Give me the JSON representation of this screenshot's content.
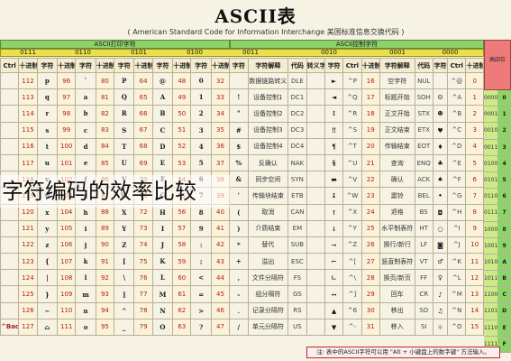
{
  "title": "ASCII表",
  "subtitle": "( American Standard Code for Information Interchange   美国标准信息交换代码 )",
  "overlay_caption": "字符编码的效率比较",
  "headers": {
    "printable": "ASCII打印字符",
    "control": "ASCII控制字符",
    "corner": "高四位"
  },
  "high_bits": [
    "0111",
    "0110",
    "0101",
    "0100",
    "0011",
    "0010",
    "0001",
    "0000"
  ],
  "col_heads": [
    "Ctrl",
    "十进制",
    "字符",
    "十进制",
    "字符",
    "十进制",
    "字符",
    "十进制",
    "字符",
    "十进制",
    "字符",
    "十进制",
    "字符",
    "字符解释",
    "代码",
    "转义字符",
    "字符",
    "Ctrl",
    "十进制",
    "字符解释",
    "代码",
    "字符",
    "Ctrl",
    "十进制"
  ],
  "rows": [
    {
      "hx": "0",
      "bin": "0000",
      "cells": [
        "",
        "112",
        "p",
        "96",
        "`",
        "80",
        "P",
        "64",
        "@",
        "48",
        "0",
        "32",
        "",
        "数据链路转义",
        "DLE",
        "",
        "►",
        "^P",
        "16",
        "空字符",
        "NUL",
        "",
        "^@",
        "0"
      ]
    },
    {
      "hx": "1",
      "bin": "0001",
      "cells": [
        "",
        "113",
        "q",
        "97",
        "a",
        "81",
        "Q",
        "65",
        "A",
        "49",
        "1",
        "33",
        "!",
        "设备控制1",
        "DC1",
        "",
        "◄",
        "^Q",
        "17",
        "标题开始",
        "SOH",
        "☺",
        "^A",
        "1"
      ]
    },
    {
      "hx": "2",
      "bin": "0010",
      "cells": [
        "",
        "114",
        "r",
        "98",
        "b",
        "82",
        "R",
        "66",
        "B",
        "50",
        "2",
        "34",
        "\"",
        "设备控制2",
        "DC2",
        "",
        "↕",
        "^R",
        "18",
        "正文开始",
        "STX",
        "☻",
        "^B",
        "2"
      ]
    },
    {
      "hx": "3",
      "bin": "0011",
      "cells": [
        "",
        "115",
        "s",
        "99",
        "c",
        "83",
        "S",
        "67",
        "C",
        "51",
        "3",
        "35",
        "#",
        "设备控制3",
        "DC3",
        "",
        "‼",
        "^S",
        "19",
        "正文结束",
        "ETX",
        "♥",
        "^C",
        "3"
      ]
    },
    {
      "hx": "4",
      "bin": "0100",
      "cells": [
        "",
        "116",
        "t",
        "100",
        "d",
        "84",
        "T",
        "68",
        "D",
        "52",
        "4",
        "36",
        "$",
        "设备控制4",
        "DC4",
        "",
        "¶",
        "^T",
        "20",
        "传输结束",
        "EOT",
        "♦",
        "^D",
        "4"
      ]
    },
    {
      "hx": "5",
      "bin": "0101",
      "cells": [
        "",
        "117",
        "u",
        "101",
        "e",
        "85",
        "U",
        "69",
        "E",
        "53",
        "5",
        "37",
        "%",
        "反确认",
        "NAK",
        "",
        "§",
        "^U",
        "21",
        "查询",
        "ENQ",
        "♣",
        "^E",
        "5"
      ]
    },
    {
      "hx": "6",
      "bin": "0110",
      "cells": [
        "",
        "118",
        "v",
        "102",
        "f",
        "86",
        "V",
        "70",
        "F",
        "54",
        "6",
        "38",
        "&",
        "同步空闲",
        "SYN",
        "",
        "▬",
        "^V",
        "22",
        "确认",
        "ACK",
        "♠",
        "^F",
        "6"
      ]
    },
    {
      "hx": "7",
      "bin": "0111",
      "cells": [
        "",
        "119",
        "w",
        "103",
        "g",
        "87",
        "W",
        "71",
        "G",
        "55",
        "7",
        "39",
        "'",
        "传输块结束",
        "ETB",
        "",
        "↨",
        "^W",
        "23",
        "震铃",
        "BEL",
        "•",
        "^G",
        "7"
      ]
    },
    {
      "hx": "8",
      "bin": "1000",
      "cells": [
        "",
        "120",
        "x",
        "104",
        "h",
        "88",
        "X",
        "72",
        "H",
        "56",
        "8",
        "40",
        "(",
        "取消",
        "CAN",
        "",
        "↑",
        "^X",
        "24",
        "退格",
        "BS",
        "◘",
        "^H",
        "8"
      ]
    },
    {
      "hx": "9",
      "bin": "1001",
      "cells": [
        "",
        "121",
        "y",
        "105",
        "i",
        "89",
        "Y",
        "73",
        "I",
        "57",
        "9",
        "41",
        ")",
        "介质结束",
        "EM",
        "",
        "↓",
        "^Y",
        "25",
        "水平制表符",
        "HT",
        "○",
        "^I",
        "9"
      ]
    },
    {
      "hx": "A",
      "bin": "1010",
      "cells": [
        "",
        "122",
        "z",
        "106",
        "j",
        "90",
        "Z",
        "74",
        "J",
        "58",
        ":",
        "42",
        "*",
        "替代",
        "SUB",
        "",
        "→",
        "^Z",
        "26",
        "换行/新行",
        "LF",
        "◙",
        "^J",
        "10"
      ]
    },
    {
      "hx": "B",
      "bin": "1011",
      "cells": [
        "",
        "123",
        "{",
        "107",
        "k",
        "91",
        "[",
        "75",
        "K",
        "59",
        ";",
        "43",
        "+",
        "溢出",
        "ESC",
        "",
        "←",
        "^[",
        "27",
        "竖直制表符",
        "VT",
        "♂",
        "^K",
        "11"
      ]
    },
    {
      "hx": "C",
      "bin": "1100",
      "cells": [
        "",
        "124",
        "|",
        "108",
        "l",
        "92",
        "\\",
        "76",
        "L",
        "60",
        "<",
        "44",
        ",",
        "文件分隔符",
        "FS",
        "",
        "∟",
        "^\\",
        "28",
        "换页/新页",
        "FF",
        "♀",
        "^L",
        "12"
      ]
    },
    {
      "hx": "D",
      "bin": "1101",
      "cells": [
        "",
        "125",
        "}",
        "109",
        "m",
        "93",
        "]",
        "77",
        "M",
        "61",
        "=",
        "45",
        "-",
        "组分隔符",
        "GS",
        "",
        "↔",
        "^]",
        "29",
        "回车",
        "CR",
        "♪",
        "^M",
        "13"
      ]
    },
    {
      "hx": "E",
      "bin": "1110",
      "cells": [
        "",
        "126",
        "~",
        "110",
        "n",
        "94",
        "^",
        "78",
        "N",
        "62",
        ">",
        "46",
        ".",
        "记录分隔符",
        "RS",
        "",
        "▲",
        "^6",
        "30",
        "移出",
        "SO",
        "♫",
        "^N",
        "14"
      ]
    },
    {
      "hx": "F",
      "bin": "1111",
      "cells": [
        "^Backspace 代码: DEL",
        "127",
        "⌂",
        "111",
        "o",
        "95",
        "_",
        "79",
        "O",
        "63",
        "?",
        "47",
        "/",
        "单元分隔符",
        "US",
        "",
        "▼",
        "^-",
        "31",
        "移入",
        "SI",
        "☼",
        "^O",
        "15"
      ]
    }
  ],
  "footnote": "注: 表中的ASCII字符可以用 \"Alt + 小键盘上的数字键\" 方法输入。"
}
